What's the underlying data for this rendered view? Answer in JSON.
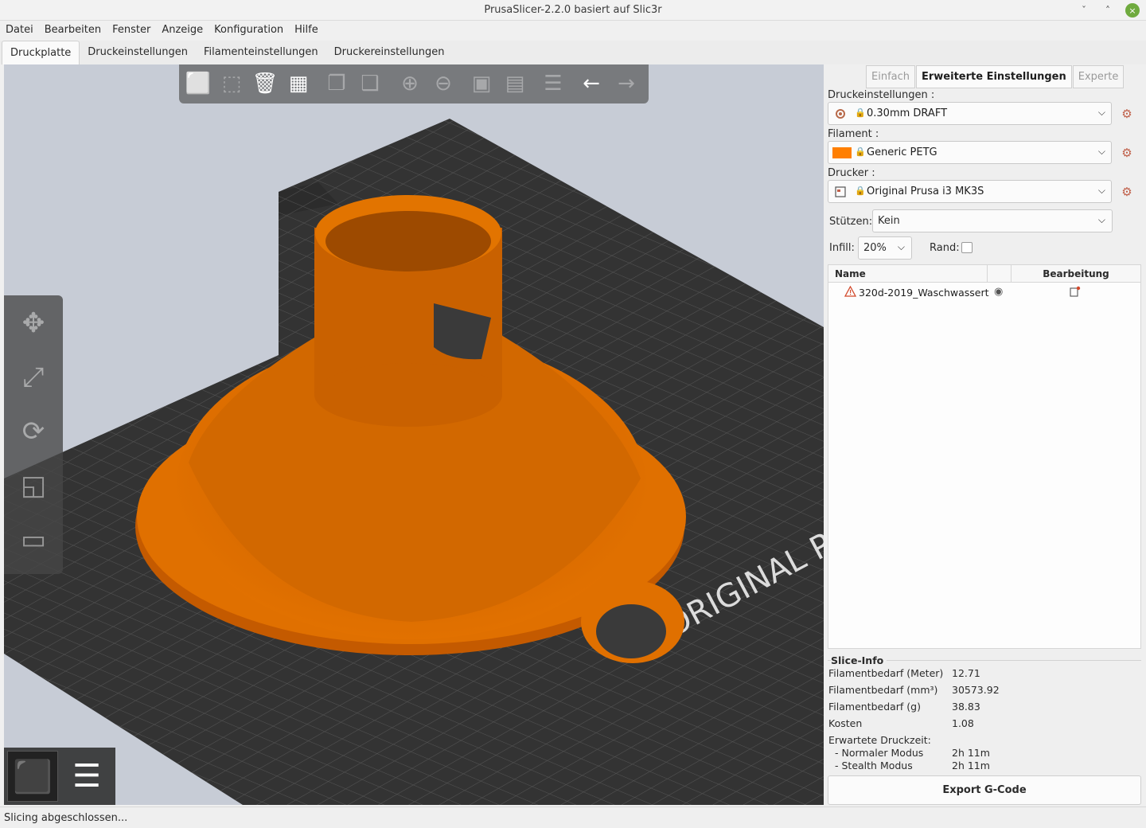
{
  "window": {
    "title": "PrusaSlicer-2.2.0 basiert auf Slic3r",
    "minimize": "ˇ",
    "maximize": "˄",
    "close": "×"
  },
  "menu": [
    "Datei",
    "Bearbeiten",
    "Fenster",
    "Anzeige",
    "Konfiguration",
    "Hilfe"
  ],
  "tabs": [
    "Druckplatte",
    "Druckeinstellungen",
    "Filamenteinstellungen",
    "Druckereinstellungen"
  ],
  "bed_label": "ORIGINAL PRU",
  "modes": [
    "Einfach",
    "Erweiterte Einstellungen",
    "Experte"
  ],
  "print_settings": {
    "label": "Druckeinstellungen :",
    "value": "0.30mm DRAFT"
  },
  "filament": {
    "label": "Filament :",
    "value": "Generic PETG",
    "color": "#ff7f00"
  },
  "printer": {
    "label": "Drucker :",
    "value": "Original Prusa i3 MK3S"
  },
  "supports": {
    "label": "Stützen:",
    "value": "Kein"
  },
  "infill": {
    "label": "Infill:",
    "value": "20%"
  },
  "brim": {
    "label": "Rand:"
  },
  "object_list": {
    "col_name": "Name",
    "col_edit": "Bearbeitung",
    "rows": [
      {
        "name": "320d-2019_Waschwassert"
      }
    ]
  },
  "slice_info": {
    "title": "Slice-Info",
    "rows": [
      {
        "label": "Filamentbedarf (Meter)",
        "value": "12.71"
      },
      {
        "label": "Filamentbedarf (mm³)",
        "value": "30573.92"
      },
      {
        "label": "Filamentbedarf (g)",
        "value": "38.83"
      },
      {
        "label": "Kosten",
        "value": "1.08"
      }
    ],
    "time_label": "Erwartete Druckzeit:",
    "time_rows": [
      {
        "label": "- Normaler Modus",
        "value": "2h 11m"
      },
      {
        "label": "- Stealth Modus",
        "value": "2h 11m"
      }
    ]
  },
  "export_button": "Export G-Code",
  "status": "Slicing abgeschlossen...",
  "colors": {
    "model": "#e07000",
    "bed": "#3a3a3a",
    "accent": "#6faa3e"
  }
}
